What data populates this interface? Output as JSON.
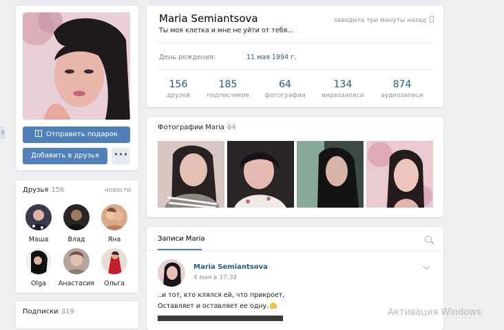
{
  "profile": {
    "name": "Maria Semiantsova",
    "online_status": "заходила три минуты назад",
    "status": "Ты моя клетка и мне не уйти от тебя...",
    "birthday_label": "День рождения:",
    "birthday_value": "11 мая 1994 г."
  },
  "actions": {
    "gift_label": "Отправить подарок",
    "add_friend_label": "Добавить в друзья",
    "more_label": "•••"
  },
  "counters": [
    {
      "value": "156",
      "label": "друзей"
    },
    {
      "value": "185",
      "label": "подписчиков"
    },
    {
      "value": "64",
      "label": "фотографии"
    },
    {
      "value": "134",
      "label": "видеозаписи"
    },
    {
      "value": "874",
      "label": "аудиозаписи"
    }
  ],
  "friends": {
    "title": "Друзья",
    "count": "156",
    "link": "новости",
    "items": [
      {
        "name": "Маша"
      },
      {
        "name": "Влад"
      },
      {
        "name": "Яна"
      },
      {
        "name": "Olga"
      },
      {
        "name": "Анастасия"
      },
      {
        "name": "Ольга"
      }
    ]
  },
  "subscriptions": {
    "title": "Подписки",
    "count": "319"
  },
  "photos": {
    "title": "Фотографии Maria",
    "count": "64"
  },
  "posts": {
    "tab_label": "Записи Maria",
    "author": "Maria Semiantsova",
    "date": "4 мая в 17:32",
    "text_line1": "..и тот, кто клялся ей, что прикроет,",
    "text_line2": "Оставляет и оставляет ее одну."
  },
  "left_edge_text": "s",
  "watermark": "Активация Windows",
  "colors": {
    "accent": "#5181b8",
    "link": "#2a5885",
    "background": "#edeef0"
  }
}
